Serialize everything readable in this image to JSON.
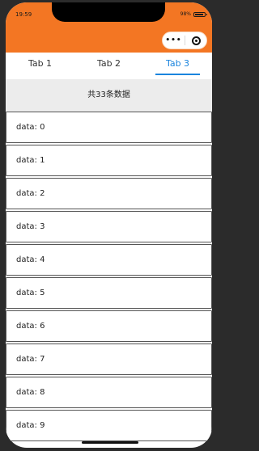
{
  "status_bar": {
    "time": "19:59",
    "battery": "98%"
  },
  "capsule": {
    "more_icon": "•••"
  },
  "tabs": [
    {
      "label": "Tab 1",
      "active": false
    },
    {
      "label": "Tab 2",
      "active": false
    },
    {
      "label": "Tab 3",
      "active": true
    }
  ],
  "summary": "共33条数据",
  "list_items": [
    "data: 0",
    "data: 1",
    "data: 2",
    "data: 3",
    "data: 4",
    "data: 5",
    "data: 6",
    "data: 7",
    "data: 8",
    "data: 9"
  ],
  "colors": {
    "header": "#f37623",
    "accent": "#1a84de",
    "summary_bg": "#ececec"
  }
}
